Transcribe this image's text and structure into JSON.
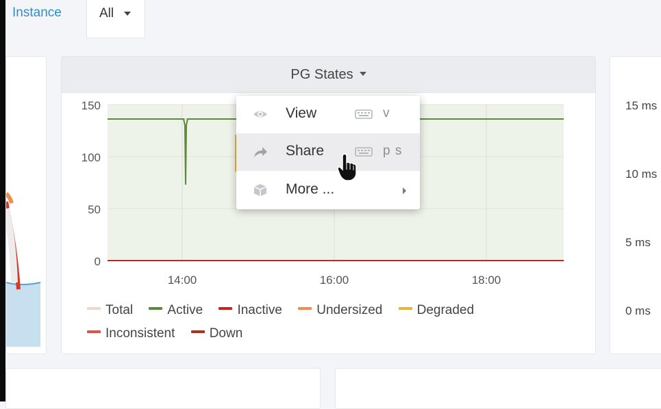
{
  "variables": {
    "label": "Instance",
    "value": "All"
  },
  "colors": {
    "link": "#2e8ec5",
    "total": "#eed8cc",
    "active": "#5b8a3a",
    "inactive": "#c0271c",
    "undersized": "#ef8d4e",
    "degraded": "#eab43a",
    "inconsistent": "#e05243",
    "down": "#b82c1c"
  },
  "pg_panel": {
    "title": "PG States",
    "y_ticks": [
      "150",
      "100",
      "50",
      "0"
    ],
    "x_ticks": [
      "14:00",
      "16:00",
      "18:00"
    ]
  },
  "chart_data": {
    "type": "line",
    "title": "PG States",
    "xlabel": "",
    "ylabel": "",
    "ylim": [
      0,
      150
    ],
    "x_ticks": [
      "14:00",
      "16:00",
      "18:00"
    ],
    "series": [
      {
        "name": "Total",
        "color": "#eed8cc",
        "values_description": null,
        "approx_value": 136
      },
      {
        "name": "Active",
        "color": "#5b8a3a",
        "approx_value": 136,
        "dip_near": "13:55",
        "dip_min": 73
      },
      {
        "name": "Inactive",
        "color": "#c0271c",
        "approx_value": 0
      },
      {
        "name": "Undersized",
        "color": "#ef8d4e",
        "approx_value": 0
      },
      {
        "name": "Degraded",
        "color": "#eab43a",
        "approx_value": 0
      },
      {
        "name": "Inconsistent",
        "color": "#e05243",
        "approx_value": 0
      },
      {
        "name": "Down",
        "color": "#b82c1c",
        "approx_value": 0
      }
    ],
    "grid": true,
    "legend": "bottom"
  },
  "legend": [
    {
      "name": "Total",
      "color": "#eed8cc"
    },
    {
      "name": "Active",
      "color": "#5b8a3a"
    },
    {
      "name": "Inactive",
      "color": "#c0271c"
    },
    {
      "name": "Undersized",
      "color": "#ef8d4e"
    },
    {
      "name": "Degraded",
      "color": "#eab43a"
    },
    {
      "name": "Inconsistent",
      "color": "#e05243"
    },
    {
      "name": "Down",
      "color": "#b82c1c"
    }
  ],
  "menu": {
    "items": [
      {
        "label": "View",
        "shortcut": "v",
        "icon": "eye-icon"
      },
      {
        "label": "Share",
        "shortcut": "p s",
        "icon": "share-icon"
      },
      {
        "label": "More ...",
        "icon": "cube-icon"
      }
    ]
  },
  "right_panel": {
    "y_ticks": [
      "15 ms",
      "10 ms",
      "5 ms",
      "0 ms"
    ]
  }
}
